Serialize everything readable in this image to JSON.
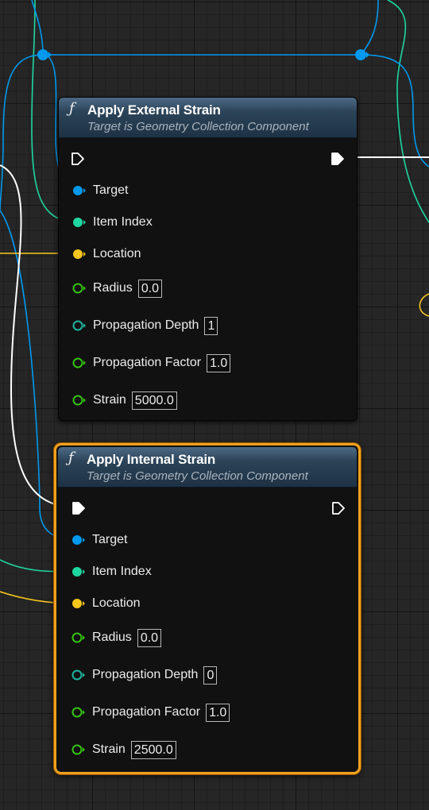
{
  "colors": {
    "exec": "#ffffff",
    "object_pin": "#0099ee",
    "integer_pin": "#1ed7a0",
    "vector_pin": "#f7c61c",
    "float_pin": "#35c311",
    "int_pin_outline": "#1eb4a0",
    "selection": "#f0a020"
  },
  "nodes": [
    {
      "title": "Apply External Strain",
      "subtitle": "Target is Geometry Collection Component",
      "icon": "function-icon",
      "selected": false,
      "pins": {
        "target": {
          "label": "Target"
        },
        "item_index": {
          "label": "Item Index"
        },
        "location": {
          "label": "Location"
        },
        "radius": {
          "label": "Radius",
          "value": "0.0"
        },
        "propagation_depth": {
          "label": "Propagation Depth",
          "value": "1"
        },
        "propagation_factor": {
          "label": "Propagation Factor",
          "value": "1.0"
        },
        "strain": {
          "label": "Strain",
          "value": "5000.0"
        }
      }
    },
    {
      "title": "Apply Internal Strain",
      "subtitle": "Target is Geometry Collection Component",
      "icon": "function-icon",
      "selected": true,
      "pins": {
        "target": {
          "label": "Target"
        },
        "item_index": {
          "label": "Item Index"
        },
        "location": {
          "label": "Location"
        },
        "radius": {
          "label": "Radius",
          "value": "0.0"
        },
        "propagation_depth": {
          "label": "Propagation Depth",
          "value": "0"
        },
        "propagation_factor": {
          "label": "Propagation Factor",
          "value": "1.0"
        },
        "strain": {
          "label": "Strain",
          "value": "2500.0"
        }
      }
    }
  ]
}
